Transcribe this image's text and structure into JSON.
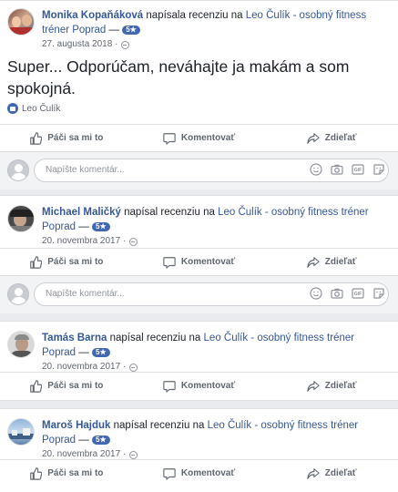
{
  "colors": {
    "link": "#365899",
    "accent": "#4267b2",
    "bg": "#e9ebee"
  },
  "actions": {
    "like": "Páči sa mi to",
    "comment": "Komentovať",
    "share": "Zdieľať"
  },
  "comment_placeholder": "Napíšte komentár...",
  "reviews": [
    {
      "author": "Monika Kopaňáková",
      "verb": "napísala recenziu na",
      "page": "Leo Čulík - osobný fitness tréner Poprad",
      "dash": "—",
      "rating": "5★",
      "date": "27. augusta 2018 · ",
      "text": "Super... Odporúčam, neváhajte ja makám a som spokojná.",
      "likes": "Leo Čulík"
    },
    {
      "author": "Michael Maličký",
      "verb": "napísal recenziu na",
      "page": "Leo Čulík - osobný fitness tréner Poprad",
      "dash": "—",
      "rating": "5★",
      "date": "20. novembra 2017 · "
    },
    {
      "author": "Tamás Barna",
      "verb": "napísal recenziu na",
      "page": "Leo Čulík - osobný fitness tréner Poprad",
      "dash": "—",
      "rating": "5★",
      "date": "20. novembra 2017 · "
    },
    {
      "author": "Maroš Hajduk",
      "verb": "napísal recenziu na",
      "page": "Leo Čulík - osobný fitness tréner Poprad",
      "dash": "—",
      "rating": "5★",
      "date": "20. novembra 2017 · "
    }
  ]
}
